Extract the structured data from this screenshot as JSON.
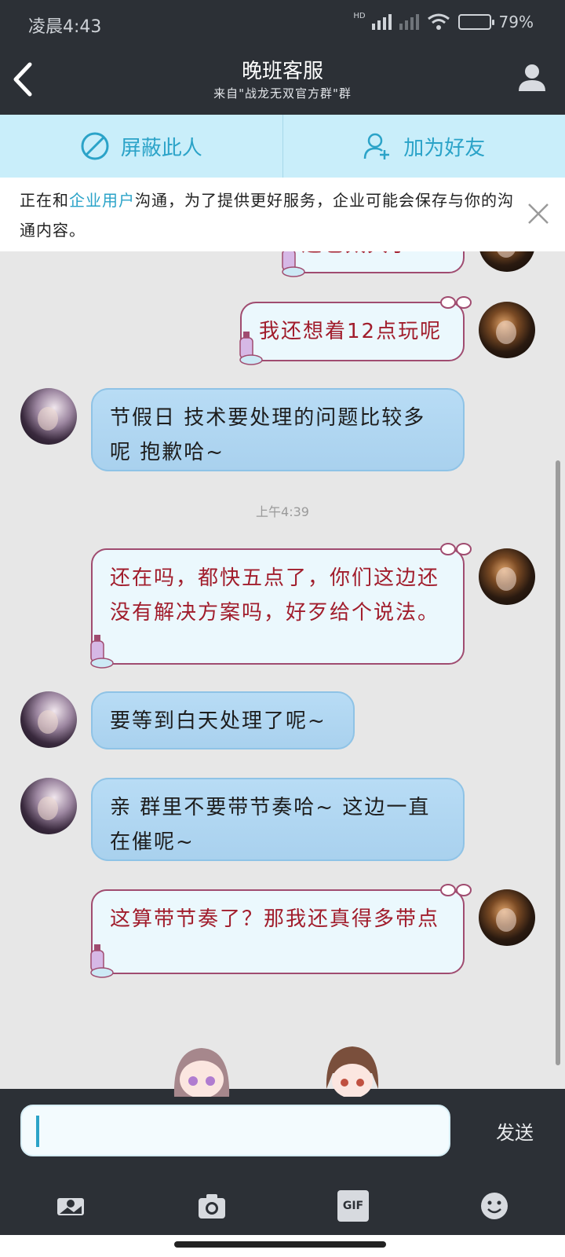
{
  "status_bar": {
    "time": "凌晨4:43",
    "network_label": "HD",
    "battery_text": "79%",
    "battery_level": 0.79
  },
  "header": {
    "title": "晚班客服",
    "subtitle": "来自\"战龙无双官方群\"群"
  },
  "actions": {
    "block_label": "屏蔽此人",
    "add_friend_label": "加为好友"
  },
  "notice": {
    "prefix": "正在和",
    "highlight": "企业用户",
    "suffix": "沟通，为了提供更好服务，企业可能会保存与你的沟通内容。"
  },
  "messages": [
    {
      "sender": "me",
      "text": "这也太久了"
    },
    {
      "sender": "me",
      "text": "我还想着12点玩呢"
    },
    {
      "sender": "agent",
      "text": "节假日  技术要处理的问题比较多呢  抱歉哈~"
    },
    {
      "sender": "me",
      "text": "还在吗，都快五点了，你们这边还没有解决方案吗，好歹给个说法。"
    },
    {
      "sender": "agent",
      "text": "要等到白天处理了呢~"
    },
    {
      "sender": "agent",
      "text": "亲 群里不要带节奏哈~  这边一直在催呢~"
    },
    {
      "sender": "me",
      "text": "这算带节奏了？那我还真得多带点"
    }
  ],
  "timestamp": "上午4:39",
  "input": {
    "send_label": "发送"
  },
  "toolbar": {
    "gif_label": "GIF"
  },
  "colors": {
    "accent": "#2ba3c8",
    "dark_bar": "#2c3036",
    "action_bg": "#c9eefa",
    "agent_bubble": "#b8dcf5",
    "me_bubble_text": "#a11d2c"
  }
}
